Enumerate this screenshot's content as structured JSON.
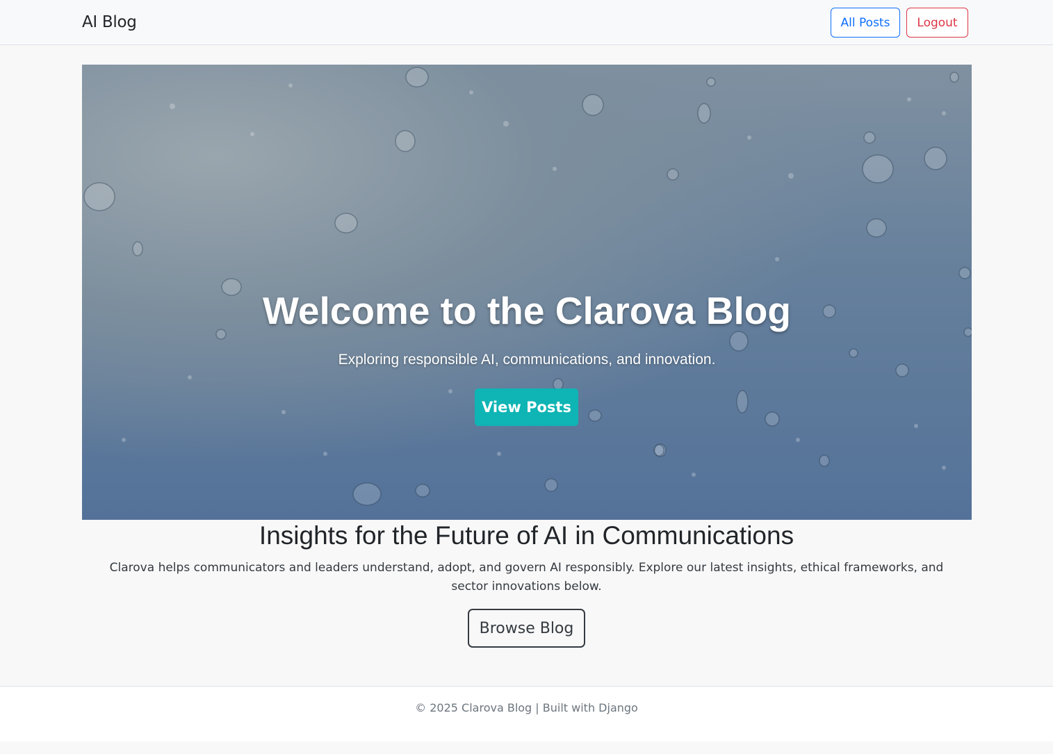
{
  "navbar": {
    "brand": "AI Blog",
    "all_posts_label": "All Posts",
    "logout_label": "Logout"
  },
  "hero": {
    "title": "Welcome to the Clarova Blog",
    "subtitle": "Exploring responsible AI, communications, and innovation.",
    "button_label": "View Posts"
  },
  "intro": {
    "title": "Insights for the Future of AI in Communications",
    "text": "Clarova helps communicators and leaders understand, adopt, and govern AI responsibly. Explore our latest insights, ethical frameworks, and sector innovations below.",
    "button_label": "Browse Blog"
  },
  "footer": {
    "text": "© 2025 Clarova Blog | Built with Django"
  },
  "colors": {
    "primary": "#0d6efd",
    "danger": "#dc3545",
    "hero_button": "#0fb4b4",
    "dark": "#343a40"
  }
}
